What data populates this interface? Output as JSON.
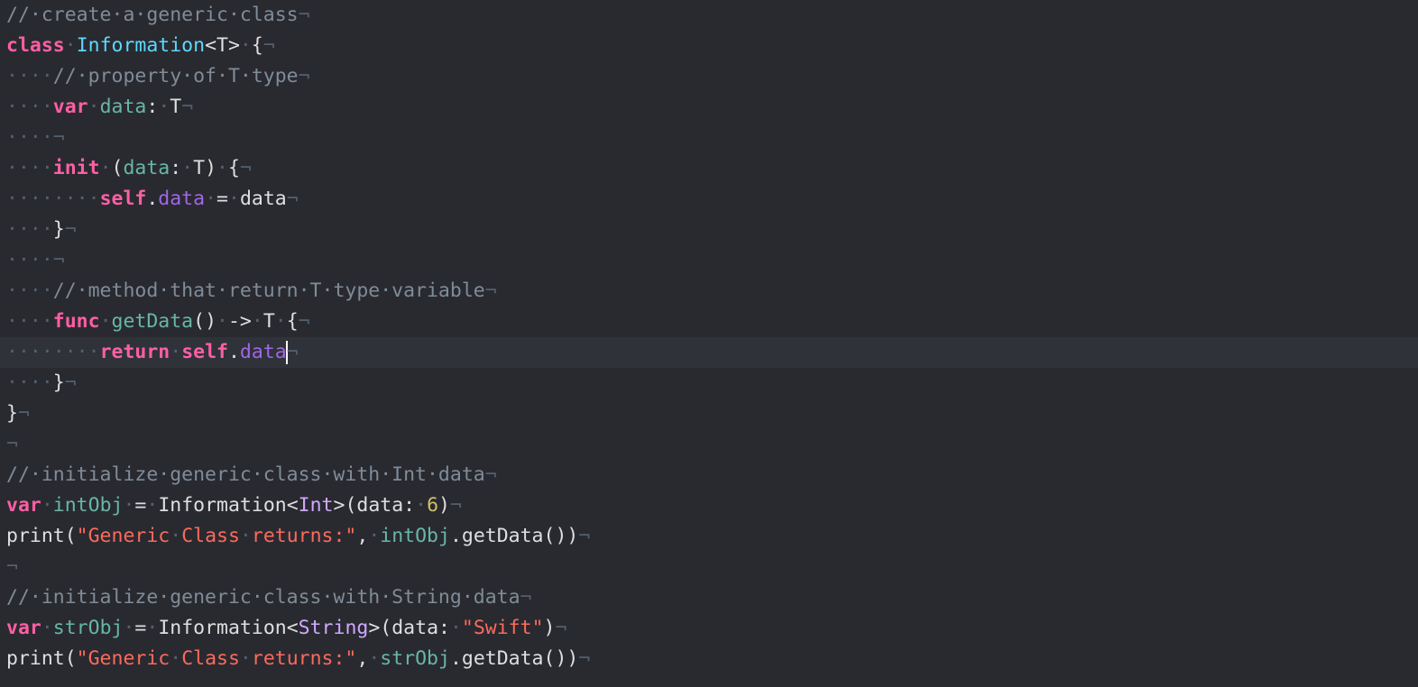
{
  "editor": {
    "theme_colors": {
      "background": "#292a30",
      "current_line": "#2f3239",
      "keyword": "#fc5fa3",
      "comment": "#7f8c98",
      "class_name": "#5dd8ff",
      "type": "#d0a8ff",
      "variable": "#67b7a4",
      "property": "#a167e6",
      "string": "#fc6a5d",
      "number": "#d0bf69",
      "invisibles": "#53606e"
    },
    "current_line_index": 11,
    "lines": [
      [
        [
          "cm",
          "//·create·a·generic·class"
        ],
        [
          "ws",
          "¬"
        ]
      ],
      [
        [
          "kw",
          "class"
        ],
        [
          "ws",
          "·"
        ],
        [
          "cls",
          "Information"
        ],
        [
          "pl",
          "<T>"
        ],
        [
          "ws",
          "·"
        ],
        [
          "pl",
          "{"
        ],
        [
          "ws",
          "¬"
        ]
      ],
      [
        [
          "ws",
          "····"
        ],
        [
          "cm",
          "//·property·of·T·type"
        ],
        [
          "ws",
          "¬"
        ]
      ],
      [
        [
          "ws",
          "····"
        ],
        [
          "kw",
          "var"
        ],
        [
          "ws",
          "·"
        ],
        [
          "var",
          "data"
        ],
        [
          "pl",
          ":"
        ],
        [
          "ws",
          "·"
        ],
        [
          "pl",
          "T"
        ],
        [
          "ws",
          "¬"
        ]
      ],
      [
        [
          "ws",
          "····¬"
        ]
      ],
      [
        [
          "ws",
          "····"
        ],
        [
          "kw",
          "init"
        ],
        [
          "ws",
          "·"
        ],
        [
          "pl",
          "("
        ],
        [
          "var",
          "data"
        ],
        [
          "pl",
          ":"
        ],
        [
          "ws",
          "·"
        ],
        [
          "pl",
          "T)"
        ],
        [
          "ws",
          "·"
        ],
        [
          "pl",
          "{"
        ],
        [
          "ws",
          "¬"
        ]
      ],
      [
        [
          "ws",
          "········"
        ],
        [
          "kw",
          "self"
        ],
        [
          "pl",
          "."
        ],
        [
          "prop",
          "data"
        ],
        [
          "ws",
          "·"
        ],
        [
          "pl",
          "="
        ],
        [
          "ws",
          "·"
        ],
        [
          "pl",
          "data"
        ],
        [
          "ws",
          "¬"
        ]
      ],
      [
        [
          "ws",
          "····"
        ],
        [
          "pl",
          "}"
        ],
        [
          "ws",
          "¬"
        ]
      ],
      [
        [
          "ws",
          "····¬"
        ]
      ],
      [
        [
          "ws",
          "····"
        ],
        [
          "cm",
          "//·method·that·return·T·type·variable"
        ],
        [
          "ws",
          "¬"
        ]
      ],
      [
        [
          "ws",
          "····"
        ],
        [
          "kw",
          "func"
        ],
        [
          "ws",
          "·"
        ],
        [
          "var",
          "getData"
        ],
        [
          "pl",
          "()"
        ],
        [
          "ws",
          "·"
        ],
        [
          "pl",
          "->"
        ],
        [
          "ws",
          "·"
        ],
        [
          "pl",
          "T"
        ],
        [
          "ws",
          "·"
        ],
        [
          "pl",
          "{"
        ],
        [
          "ws",
          "¬"
        ]
      ],
      [
        [
          "ws",
          "········"
        ],
        [
          "kw",
          "return"
        ],
        [
          "ws",
          "·"
        ],
        [
          "kw",
          "self"
        ],
        [
          "pl",
          "."
        ],
        [
          "prop",
          "data"
        ],
        [
          "caret",
          ""
        ],
        [
          "ws",
          "¬"
        ]
      ],
      [
        [
          "ws",
          "····"
        ],
        [
          "pl",
          "}"
        ],
        [
          "ws",
          "¬"
        ]
      ],
      [
        [
          "pl",
          "}"
        ],
        [
          "ws",
          "¬"
        ]
      ],
      [
        [
          "ws",
          "¬"
        ]
      ],
      [
        [
          "cm",
          "//·initialize·generic·class·with·Int·data"
        ],
        [
          "ws",
          "¬"
        ]
      ],
      [
        [
          "kw",
          "var"
        ],
        [
          "ws",
          "·"
        ],
        [
          "var",
          "intObj"
        ],
        [
          "ws",
          "·"
        ],
        [
          "pl",
          "="
        ],
        [
          "ws",
          "·"
        ],
        [
          "pl",
          "Information<"
        ],
        [
          "typ",
          "Int"
        ],
        [
          "pl",
          ">(data:"
        ],
        [
          "ws",
          "·"
        ],
        [
          "num",
          "6"
        ],
        [
          "pl",
          ")"
        ],
        [
          "ws",
          "¬"
        ]
      ],
      [
        [
          "pl",
          "print("
        ],
        [
          "str",
          "\"Generic"
        ],
        [
          "ws",
          "·"
        ],
        [
          "str",
          "Class"
        ],
        [
          "ws",
          "·"
        ],
        [
          "str",
          "returns:\""
        ],
        [
          "pl",
          ","
        ],
        [
          "ws",
          "·"
        ],
        [
          "var",
          "intObj"
        ],
        [
          "pl",
          ".getData())"
        ],
        [
          "ws",
          "¬"
        ]
      ],
      [
        [
          "ws",
          "¬"
        ]
      ],
      [
        [
          "cm",
          "//·initialize·generic·class·with·String·data"
        ],
        [
          "ws",
          "¬"
        ]
      ],
      [
        [
          "kw",
          "var"
        ],
        [
          "ws",
          "·"
        ],
        [
          "var",
          "strObj"
        ],
        [
          "ws",
          "·"
        ],
        [
          "pl",
          "="
        ],
        [
          "ws",
          "·"
        ],
        [
          "pl",
          "Information<"
        ],
        [
          "typ",
          "String"
        ],
        [
          "pl",
          ">(data:"
        ],
        [
          "ws",
          "·"
        ],
        [
          "str",
          "\"Swift\""
        ],
        [
          "pl",
          ")"
        ],
        [
          "ws",
          "¬"
        ]
      ],
      [
        [
          "pl",
          "print("
        ],
        [
          "str",
          "\"Generic"
        ],
        [
          "ws",
          "·"
        ],
        [
          "str",
          "Class"
        ],
        [
          "ws",
          "·"
        ],
        [
          "str",
          "returns:\""
        ],
        [
          "pl",
          ","
        ],
        [
          "ws",
          "·"
        ],
        [
          "var",
          "strObj"
        ],
        [
          "pl",
          ".getData())"
        ],
        [
          "ws",
          "¬"
        ]
      ]
    ]
  }
}
